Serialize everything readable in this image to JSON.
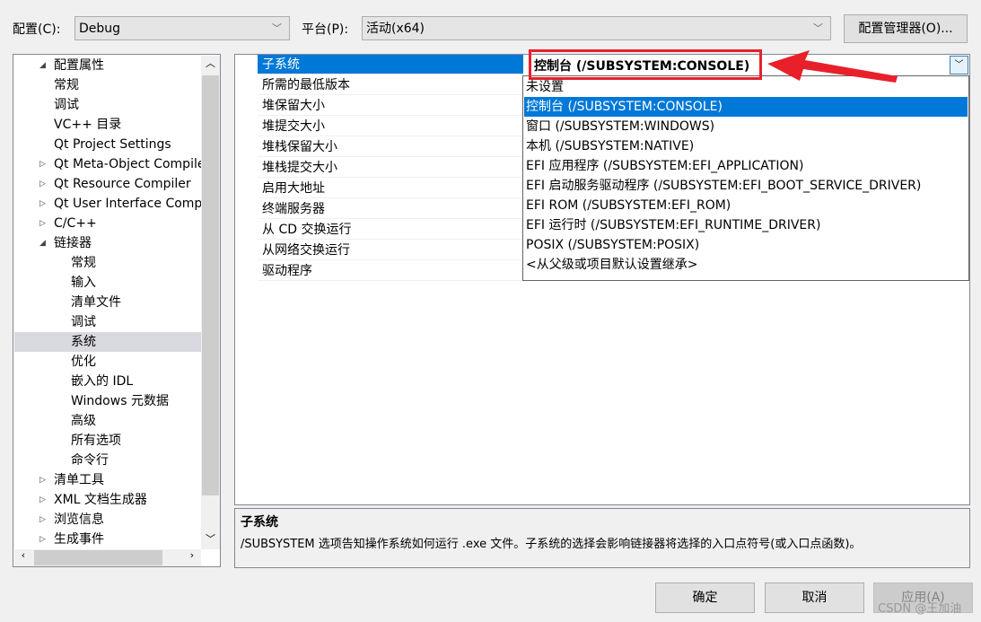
{
  "top": {
    "config_label": "配置(C):",
    "config_value": "Debug",
    "platform_label": "平台(P):",
    "platform_value": "活动(x64)",
    "config_manager": "配置管理器(O)..."
  },
  "tree": [
    {
      "label": "配置属性",
      "level": 0,
      "exp": "expanded"
    },
    {
      "label": "常规",
      "level": 1
    },
    {
      "label": "调试",
      "level": 1
    },
    {
      "label": "VC++ 目录",
      "level": 1
    },
    {
      "label": "Qt Project Settings",
      "level": 1
    },
    {
      "label": "Qt Meta-Object Compiler",
      "level": 1,
      "exp": "collapsed"
    },
    {
      "label": "Qt Resource Compiler",
      "level": 1,
      "exp": "collapsed"
    },
    {
      "label": "Qt User Interface Compiler",
      "level": 1,
      "exp": "collapsed"
    },
    {
      "label": "C/C++",
      "level": 1,
      "exp": "collapsed"
    },
    {
      "label": "链接器",
      "level": 1,
      "exp": "expanded"
    },
    {
      "label": "常规",
      "level": 2
    },
    {
      "label": "输入",
      "level": 2
    },
    {
      "label": "清单文件",
      "level": 2
    },
    {
      "label": "调试",
      "level": 2
    },
    {
      "label": "系统",
      "level": 2,
      "selected": true
    },
    {
      "label": "优化",
      "level": 2
    },
    {
      "label": "嵌入的 IDL",
      "level": 2
    },
    {
      "label": "Windows 元数据",
      "level": 2
    },
    {
      "label": "高级",
      "level": 2
    },
    {
      "label": "所有选项",
      "level": 2
    },
    {
      "label": "命令行",
      "level": 2
    },
    {
      "label": "清单工具",
      "level": 1,
      "exp": "collapsed"
    },
    {
      "label": "XML 文档生成器",
      "level": 1,
      "exp": "collapsed"
    },
    {
      "label": "浏览信息",
      "level": 1,
      "exp": "collapsed"
    },
    {
      "label": "生成事件",
      "level": 1,
      "exp": "collapsed"
    }
  ],
  "properties": [
    "子系统",
    "所需的最低版本",
    "堆保留大小",
    "堆提交大小",
    "堆栈保留大小",
    "堆栈提交大小",
    "启用大地址",
    "终端服务器",
    "从 CD 交换运行",
    "从网络交换运行",
    "驱动程序"
  ],
  "current_value": "控制台 (/SUBSYSTEM:CONSOLE)",
  "options": [
    "未设置",
    "控制台 (/SUBSYSTEM:CONSOLE)",
    "窗口 (/SUBSYSTEM:WINDOWS)",
    "本机 (/SUBSYSTEM:NATIVE)",
    "EFI 应用程序 (/SUBSYSTEM:EFI_APPLICATION)",
    "EFI 启动服务驱动程序 (/SUBSYSTEM:EFI_BOOT_SERVICE_DRIVER)",
    "EFI ROM (/SUBSYSTEM:EFI_ROM)",
    "EFI 运行时 (/SUBSYSTEM:EFI_RUNTIME_DRIVER)",
    "POSIX (/SUBSYSTEM:POSIX)",
    "<从父级或项目默认设置继承>"
  ],
  "selected_option": 1,
  "description": {
    "title": "子系统",
    "text": "/SUBSYSTEM 选项告知操作系统如何运行 .exe 文件。子系统的选择会影响链接器将选择的入口点符号(或入口点函数)。"
  },
  "buttons": {
    "ok": "确定",
    "cancel": "取消",
    "apply": "应用(A)"
  },
  "watermark": "CSDN @王加油",
  "colors": {
    "selection": "#0078d7",
    "annotation": "#e8202a"
  }
}
